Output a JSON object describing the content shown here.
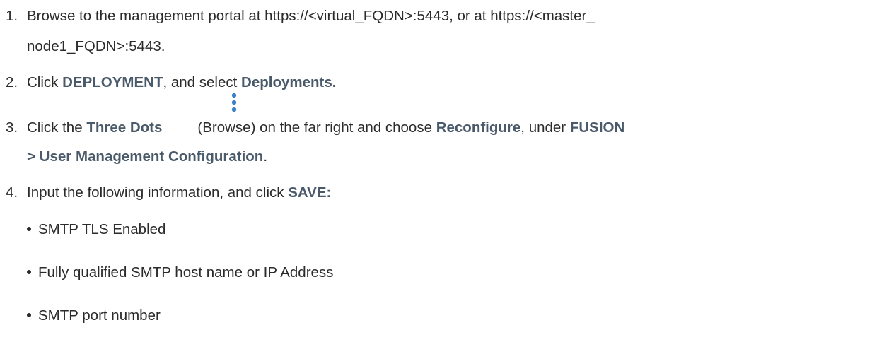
{
  "steps": [
    {
      "number": "1.",
      "line1": "Browse to the management portal at https://<virtual_FQDN>:5443, or at https://<master_",
      "line2": "node1_FQDN>:5443."
    },
    {
      "number": "2.",
      "text_a": "Click ",
      "kw_a": "DEPLOYMENT",
      "text_b": ", and select ",
      "kw_b": "Deployments."
    },
    {
      "number": "3.",
      "text_a": "Click the ",
      "kw_a": "Three Dots",
      "text_b": "(Browse) on the far right and choose ",
      "kw_b": "Reconfigure",
      "text_c": ", under ",
      "kw_c": "FUSION",
      "kw_d": "> User Management Configuration",
      "text_d": ".",
      "icon": "three-dots-vertical-icon",
      "icon_color": "#3b82c4"
    },
    {
      "number": "4.",
      "text_a": "Input the following information, and click ",
      "kw_a": "SAVE:"
    }
  ],
  "bullets": [
    "SMTP TLS Enabled",
    "Fully qualified SMTP host name or IP Address",
    "SMTP port number"
  ]
}
